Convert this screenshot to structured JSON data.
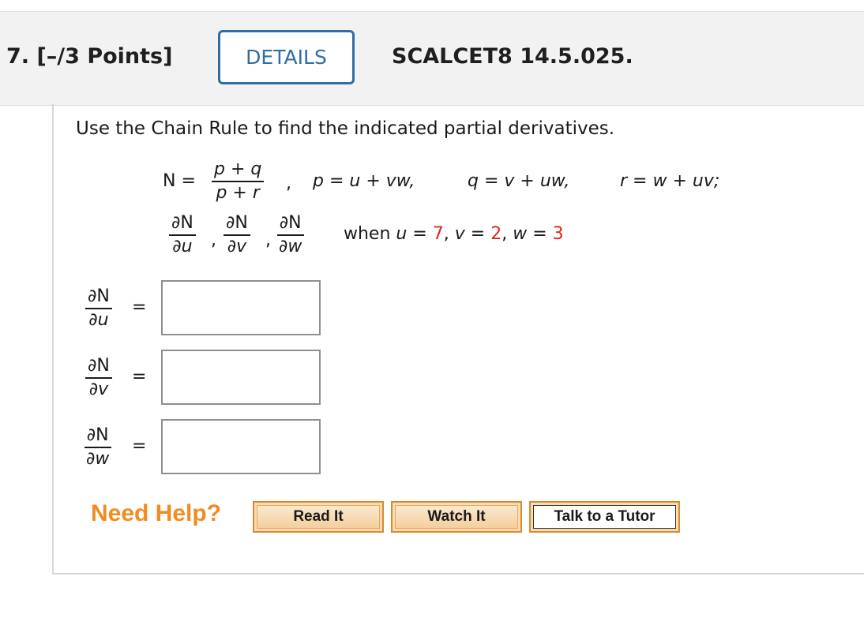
{
  "header": {
    "question_title": "7.  [–/3 Points]",
    "details_label": "DETAILS",
    "problem_id": "SCALCET8 14.5.025."
  },
  "question": {
    "prompt": "Use the Chain Rule to find the indicated partial derivatives.",
    "N_lhs": "N =",
    "N_numerator": "p + q",
    "N_denominator": "p + r",
    "comma": ",",
    "p_def": "p = u + vw,",
    "q_def": "q = v + uw,",
    "r_def": "r = w + uv;",
    "partial_numerator": "∂N",
    "wrt_u": "∂u",
    "wrt_v": "∂v",
    "wrt_w": "∂w",
    "when_text": "when",
    "u_label": "u =",
    "u_value": "7",
    "v_label": "v =",
    "v_value": "2",
    "w_label": "w =",
    "w_value": "3",
    "sep": ",",
    "equals": "="
  },
  "answers": [
    {
      "value": ""
    },
    {
      "value": ""
    },
    {
      "value": ""
    }
  ],
  "help": {
    "label": "Need Help?",
    "read_it": "Read It",
    "watch_it": "Watch It",
    "talk_to_tutor": "Talk to a Tutor"
  },
  "colors": {
    "accent_blue": "#2f6da4",
    "given_value_red": "#d9281e",
    "help_orange": "#f08c22"
  }
}
